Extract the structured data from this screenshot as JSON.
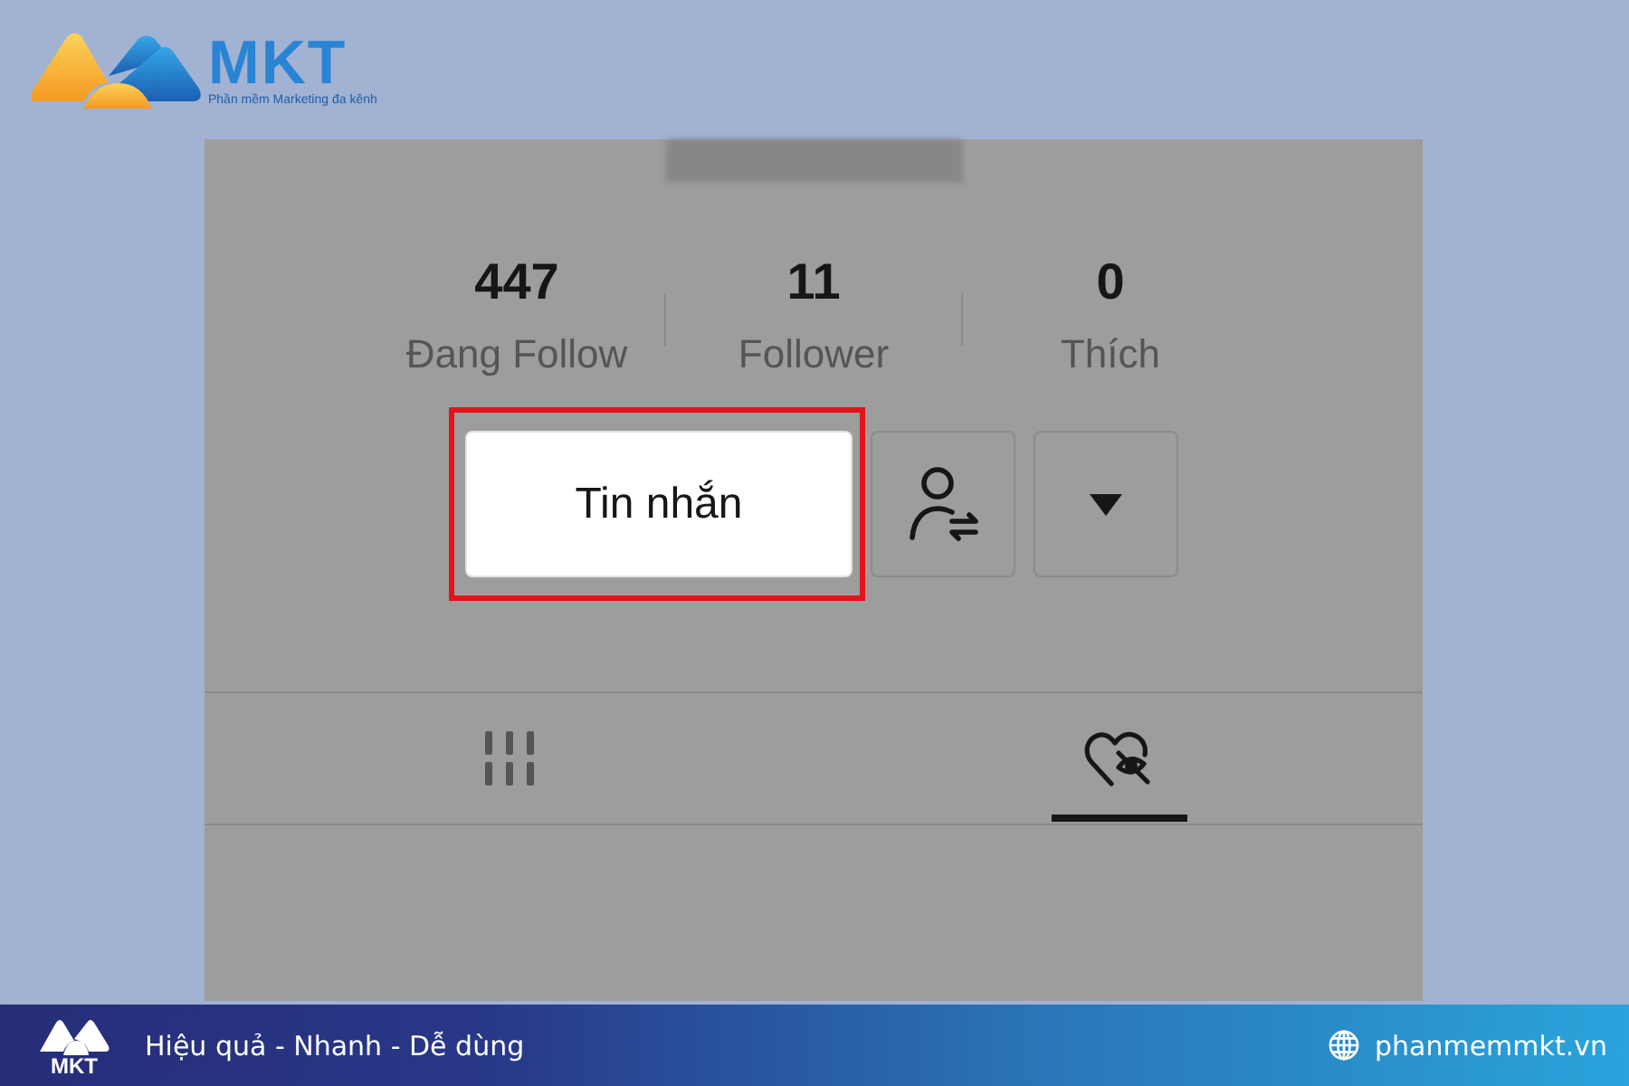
{
  "logo": {
    "wordmark": "MKT",
    "tagline": "Phần mềm Marketing đa kênh"
  },
  "profile": {
    "stats": [
      {
        "value": "447",
        "label": "Đang Follow"
      },
      {
        "value": "11",
        "label": "Follower"
      },
      {
        "value": "0",
        "label": "Thích"
      }
    ],
    "actions": [
      {
        "kind": "message",
        "label": "Tin nhắn",
        "highlighted": true
      },
      {
        "kind": "switch-account",
        "highlighted": false
      },
      {
        "kind": "dropdown",
        "highlighted": false
      }
    ],
    "tabs": [
      {
        "kind": "grid",
        "selected": false
      },
      {
        "kind": "liked",
        "selected": true
      }
    ]
  },
  "footer": {
    "logo_text": "MKT",
    "slogan": "Hiệu quả - Nhanh - Dễ dùng",
    "website": "phanmemmkt.vn"
  }
}
